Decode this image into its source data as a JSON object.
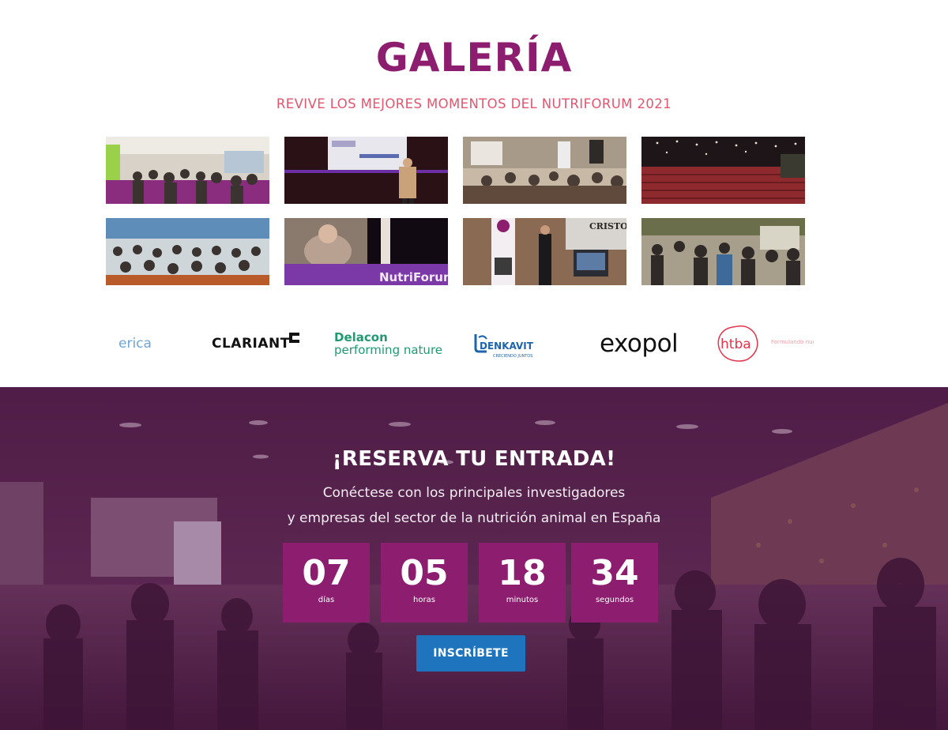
{
  "gallery": {
    "title": "GALERÍA",
    "subtitle": "REVIVE LOS MEJORES MOMENTOS DEL NUTRIFORUM 2021",
    "photos": [
      {
        "name": "expo-hall-crowd"
      },
      {
        "name": "speaker-on-stage"
      },
      {
        "name": "seated-audience"
      },
      {
        "name": "auditorium-red-seats"
      },
      {
        "name": "conference-audience"
      },
      {
        "name": "video-speaker-stage"
      },
      {
        "name": "registration-desk"
      },
      {
        "name": "networking-crowd"
      }
    ]
  },
  "sponsors": {
    "iberica": "erica",
    "clariant": "CLARIANT",
    "delacon_name": "Delacon",
    "delacon_tagline": "performing nature",
    "denkavit": "DENKAVIT",
    "denkavit_tagline": "CRECIENDO JUNTOS",
    "exopol": "exopol",
    "htba": "htba",
    "htba_tagline": "Formulando nuevo alimento"
  },
  "reserve": {
    "title": "¡RESERVA TU ENTRADA!",
    "line1": "Conéctese con los principales investigadores",
    "line2": "y empresas del sector de la nutrición animal en España",
    "countdown": [
      {
        "value": "07",
        "unit": "días"
      },
      {
        "value": "05",
        "unit": "horas"
      },
      {
        "value": "18",
        "unit": "minutos"
      },
      {
        "value": "34",
        "unit": "segundos"
      }
    ],
    "cta_label": "INSCRÍBETE"
  },
  "colors": {
    "brand_purple": "#8d1d6f",
    "subtitle_pink": "#e4556e",
    "cta_blue": "#1e75bd"
  }
}
